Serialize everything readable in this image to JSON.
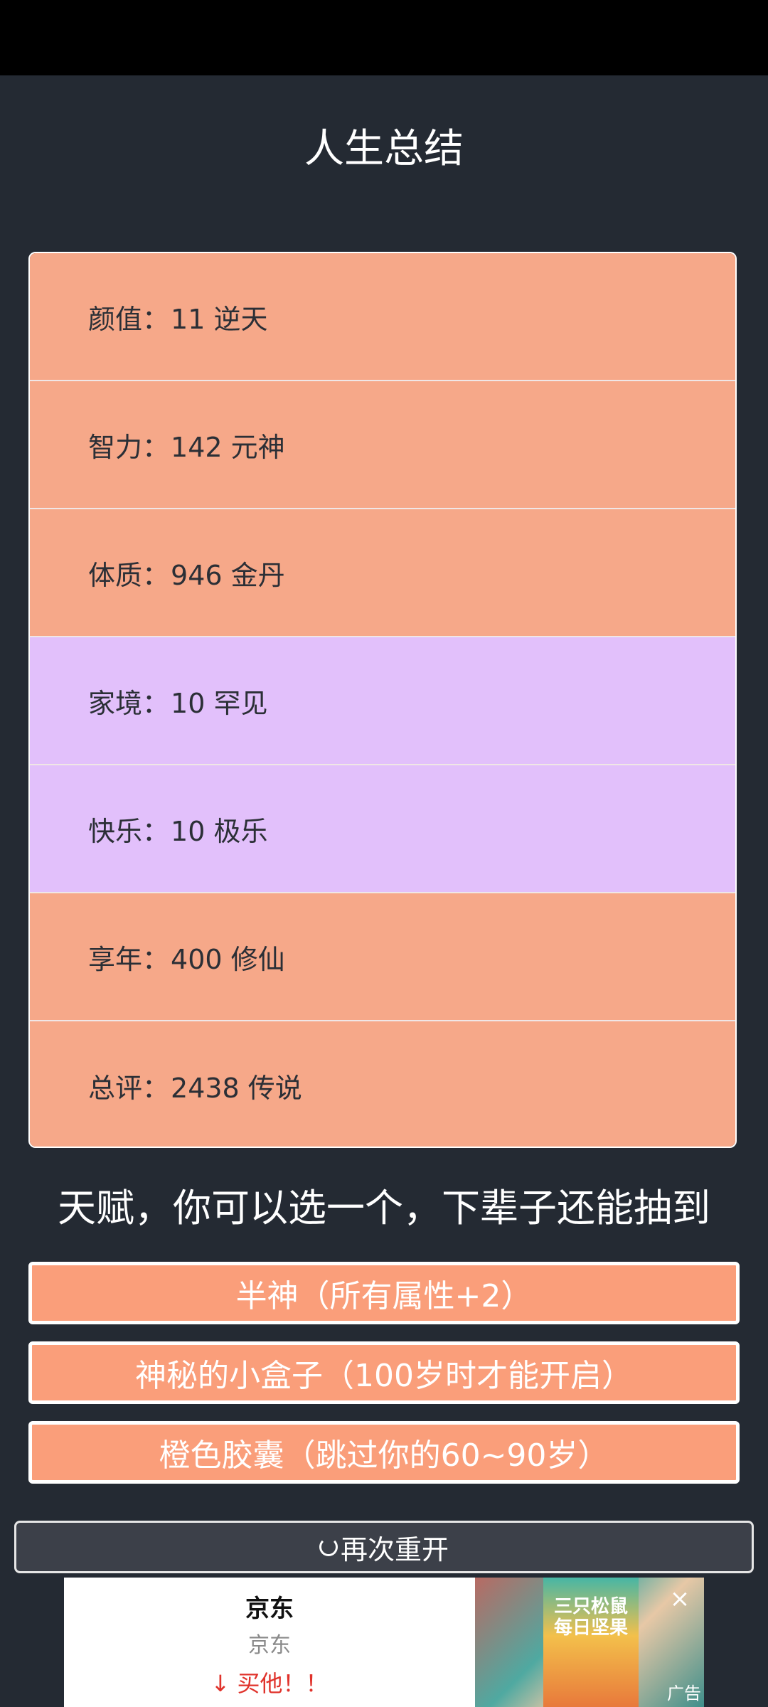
{
  "title": "人生总结",
  "stats": [
    {
      "label": "颜值：",
      "value": "11 逆天",
      "tier": "orange"
    },
    {
      "label": "智力：",
      "value": "142 元神",
      "tier": "orange"
    },
    {
      "label": "体质：",
      "value": "946 金丹",
      "tier": "orange"
    },
    {
      "label": "家境：",
      "value": "10 罕见",
      "tier": "purple"
    },
    {
      "label": "快乐：",
      "value": "10 极乐",
      "tier": "purple"
    },
    {
      "label": "享年：",
      "value": "400 修仙",
      "tier": "orange"
    },
    {
      "label": "总评：",
      "value": "2438 传说",
      "tier": "orange"
    }
  ],
  "talent_heading": "天赋，你可以选一个，下辈子还能抽到",
  "talents": [
    "半神（所有属性+2）",
    "神秘的小盒子（100岁时才能开启）",
    "橙色胶囊（跳过你的60~90岁）"
  ],
  "restart_label": "再次重开",
  "ad": {
    "title": "京东",
    "subtitle": "京东",
    "cta": "↓ 买他！！",
    "product_text": "三只松鼠 每日坚果",
    "close": "×",
    "label": "广告"
  },
  "colors": {
    "background": "#242a33",
    "orange_tier": "#f6a889",
    "purple_tier": "#e2c0fb",
    "talent_button": "#fa9e7a"
  }
}
